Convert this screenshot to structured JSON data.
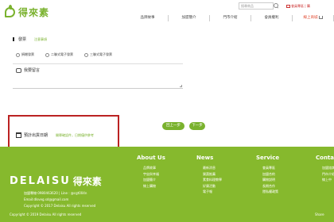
{
  "header": {
    "logo_text": "得來素",
    "search_placeholder": "搜尋商品",
    "top_links": "會員專區 | 購",
    "nav": [
      "品牌故事",
      "加盟簡介",
      "門市介紹",
      "會員權利",
      "線上商城"
    ]
  },
  "form": {
    "invoice": {
      "title": "發票",
      "note": "注意事項",
      "options": [
        "捐贈發票",
        "二聯式電子發票",
        "三聯式電子發票"
      ]
    },
    "message": {
      "title": "我要留言"
    },
    "delivery": {
      "label": "預計出貨日期",
      "note": "開單確認件，日期僅供參考"
    },
    "buttons": {
      "prev": "回上一步",
      "next": "下一步"
    }
  },
  "footer": {
    "brand": "DELAISU",
    "brand_cn": "得來素",
    "info": [
      "加盟專線:0980463620 | Line : @cgt004n",
      "Email:dlsveg.sd@gmail.com",
      "Copyright © 2017 Delaisu All rights reserved"
    ],
    "columns": [
      {
        "title": "About Us",
        "links": [
          "品牌故事",
          "宇宙與幸福",
          "加盟簡介",
          "線上購物"
        ]
      },
      {
        "title": "News",
        "links": [
          "最新消息",
          "樂蔬推薦",
          "素食料理教學",
          "好康活動",
          "電子報"
        ]
      },
      {
        "title": "Service",
        "links": [
          "會員專區",
          "加盟合約",
          "購物說明",
          "長期合作",
          "隱私權政策"
        ]
      },
      {
        "title": "Contact",
        "links": [
          "加盟諮詢",
          "門市介紹",
          "線上中"
        ]
      }
    ],
    "copyright": "Copyright © 2019 Delaisu All rights reserved",
    "share": "Share"
  },
  "colors": {
    "brand_green": "#86b92d",
    "highlight_red": "#bb2222"
  }
}
